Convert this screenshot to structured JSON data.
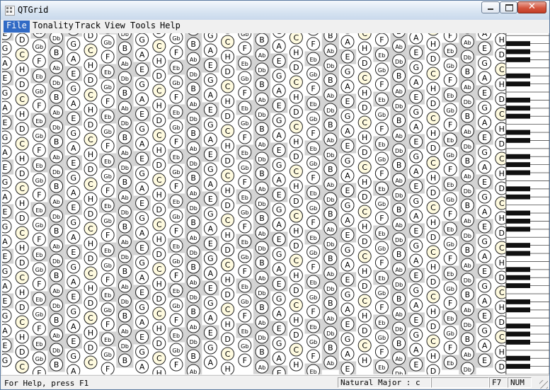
{
  "window": {
    "title": "QTGrid"
  },
  "menu": [
    "File",
    "Tonality",
    "Track",
    "View",
    "Tools",
    "Help"
  ],
  "active_menu": "File",
  "grid": {
    "selected_note": "Eb",
    "columns": [
      {
        "n": "A",
        "type": "white"
      },
      {
        "n": "B",
        "type": "white"
      },
      {
        "n": "Gb",
        "type": "white"
      },
      {
        "n": "D",
        "type": "white"
      },
      {
        "n": "E",
        "type": "white"
      },
      {
        "n": "Ab",
        "type": "gray"
      },
      {
        "n": "F",
        "type": "white"
      },
      {
        "n": "C",
        "type": "tonic"
      },
      {
        "n": "G",
        "type": "white"
      },
      {
        "n": "Db",
        "type": "gray"
      },
      {
        "n": "Eb",
        "type": "gray"
      },
      {
        "n": "H",
        "type": "white"
      }
    ],
    "colors": {
      "tonic": "#fffbe0",
      "shade": "#d3d3d3",
      "ring": "#222222"
    }
  },
  "status": {
    "help": "For Help, press F1",
    "scale": "Natural Major : c",
    "extra": "",
    "key": "F7",
    "num": "NUM"
  },
  "icons": [
    "app-icon",
    "minimize-icon",
    "maximize-icon",
    "close-icon"
  ]
}
